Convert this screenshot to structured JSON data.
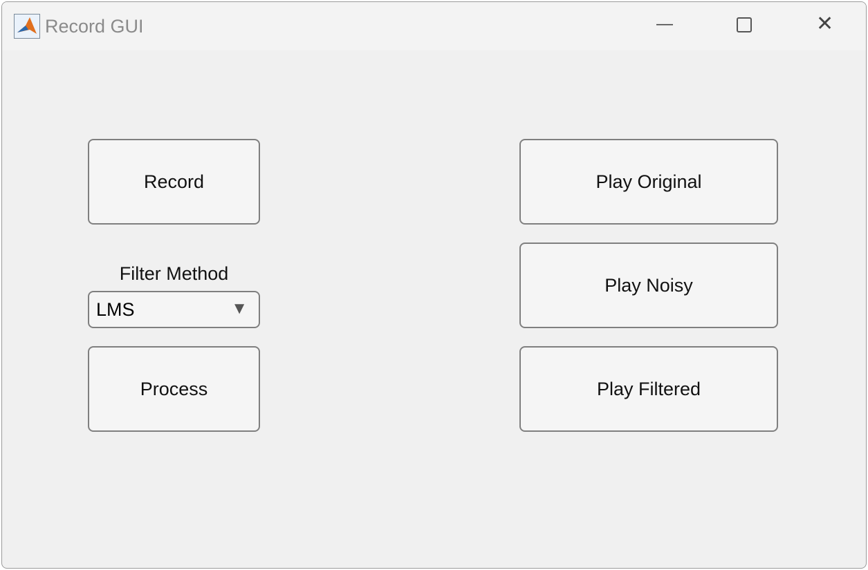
{
  "window": {
    "title": "Record GUI",
    "icon": "matlab-logo-icon"
  },
  "buttons": {
    "record": "Record",
    "process": "Process",
    "play_original": "Play Original",
    "play_noisy": "Play Noisy",
    "play_filtered": "Play Filtered"
  },
  "filter": {
    "label": "Filter Method",
    "value": "LMS"
  }
}
